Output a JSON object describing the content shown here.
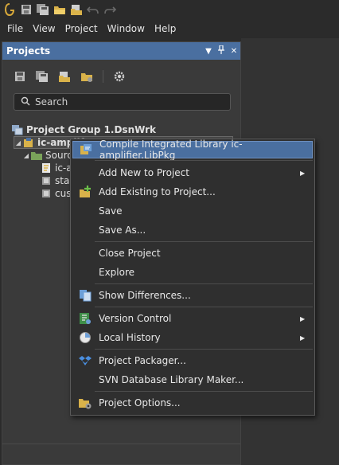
{
  "menubar": {
    "items": [
      {
        "label": "File"
      },
      {
        "label": "View"
      },
      {
        "label": "Project"
      },
      {
        "label": "Window"
      },
      {
        "label": "Help"
      }
    ]
  },
  "panel": {
    "title": "Projects",
    "header_buttons": [
      "dropdown-icon",
      "pin-icon",
      "close-icon"
    ],
    "toolbar_icons": [
      "save-icon",
      "save-all-icon",
      "open-project-icon",
      "open-folder-icon",
      "settings-icon"
    ],
    "search": {
      "placeholder": "Search",
      "value": ""
    }
  },
  "tree": {
    "group": "Project Group 1.DsnWrk",
    "project": "ic-amplif",
    "folder": "Sourc",
    "files": [
      "ic-a",
      "stan",
      "cust"
    ]
  },
  "context_menu": {
    "items": [
      {
        "label": "Compile Integrated Library ic-amplifier.LibPkg",
        "icon": "compile-icon",
        "highlighted": true
      },
      {
        "label": "Add New to Project",
        "submenu": true
      },
      {
        "label": "Add Existing to Project...",
        "icon": "add-existing-icon"
      },
      {
        "label": "Save"
      },
      {
        "label": "Save As..."
      },
      {
        "label": "Close Project"
      },
      {
        "label": "Explore"
      },
      {
        "label": "Show Differences...",
        "icon": "differences-icon"
      },
      {
        "label": "Version Control",
        "icon": "version-control-icon",
        "submenu": true
      },
      {
        "label": "Local History",
        "icon": "local-history-icon",
        "submenu": true
      },
      {
        "label": "Project Packager...",
        "icon": "packager-icon"
      },
      {
        "label": "SVN Database Library Maker..."
      },
      {
        "label": "Project Options...",
        "icon": "project-options-icon"
      }
    ]
  },
  "colors": {
    "accent": "#4a6fa0",
    "background": "#2b2b2b",
    "panel": "#3a3a3a",
    "menu": "#2f2f2f"
  }
}
